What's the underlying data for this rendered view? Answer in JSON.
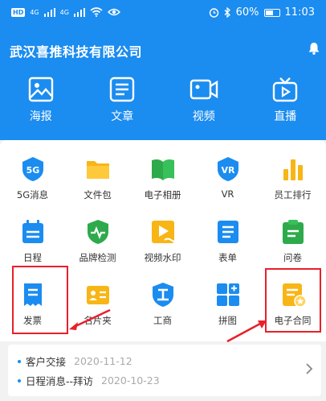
{
  "status": {
    "hd": "HD",
    "signal1": "4G",
    "signal2": "4G",
    "battery_percent": "60%",
    "battery_level": 0.6,
    "time": "11:03"
  },
  "header": {
    "company": "武汉喜推科技有限公司"
  },
  "quick": [
    {
      "label": "海报",
      "icon": "poster-icon"
    },
    {
      "label": "文章",
      "icon": "article-icon"
    },
    {
      "label": "视频",
      "icon": "video-icon"
    },
    {
      "label": "直播",
      "icon": "live-icon"
    }
  ],
  "grid": [
    {
      "label": "5G消息",
      "icon": "5g-icon",
      "color": "#1b8cf0"
    },
    {
      "label": "文件包",
      "icon": "folder-icon",
      "color": "#f8b516"
    },
    {
      "label": "电子相册",
      "icon": "album-icon",
      "color": "#2eaa4c"
    },
    {
      "label": "VR",
      "icon": "vr-icon",
      "color": "#1b8cf0"
    },
    {
      "label": "员工排行",
      "icon": "bar-chart-icon",
      "color": "#f8b516"
    },
    {
      "label": "日程",
      "icon": "calendar-icon",
      "color": "#1b8cf0"
    },
    {
      "label": "品牌检测",
      "icon": "shield-icon",
      "color": "#2eaa4c"
    },
    {
      "label": "视频水印",
      "icon": "video-watermark-icon",
      "color": "#f8b516"
    },
    {
      "label": "表单",
      "icon": "form-icon",
      "color": "#1b8cf0"
    },
    {
      "label": "问卷",
      "icon": "questionnaire-icon",
      "color": "#2eaa4c"
    },
    {
      "label": "发票",
      "icon": "invoice-icon",
      "color": "#1b8cf0"
    },
    {
      "label": "名片夹",
      "icon": "card-holder-icon",
      "color": "#f8b516"
    },
    {
      "label": "工商",
      "icon": "business-icon",
      "color": "#1b8cf0"
    },
    {
      "label": "拼图",
      "icon": "puzzle-icon",
      "color": "#1b8cf0"
    },
    {
      "label": "电子合同",
      "icon": "contract-icon",
      "color": "#f8b516"
    }
  ],
  "news": [
    {
      "title": "客户交接",
      "date": "2020-11-12"
    },
    {
      "title": "日程消息--拜访",
      "date": "2020-10-23"
    }
  ],
  "colors": {
    "primary": "#1b8cf0",
    "highlight": "#e8202a"
  }
}
